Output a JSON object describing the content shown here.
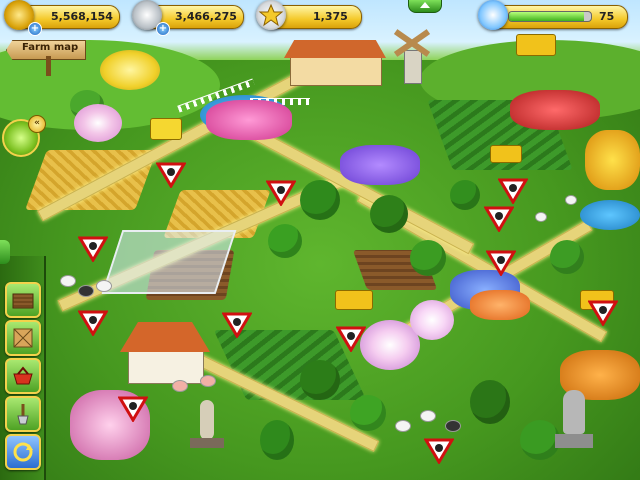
{
  "hud": {
    "coins": {
      "value": "5,568,154",
      "icon": "gold-coins-icon"
    },
    "silver": {
      "value": "3,466,275",
      "icon": "silver-coin-icon"
    },
    "stars": {
      "value": "1,375",
      "icon": "star-icon"
    },
    "energy": {
      "value": "75",
      "fill_fraction": 0.92,
      "icon": "farmer-avatar-icon"
    }
  },
  "farm_map": {
    "label": "Farm map"
  },
  "toolbar": {
    "tools": [
      {
        "icon": "field-plot-icon"
      },
      {
        "icon": "wooden-crate-icon"
      },
      {
        "icon": "shopping-basket-icon"
      },
      {
        "icon": "shovel-icon"
      },
      {
        "icon": "recycle-icon"
      }
    ]
  },
  "colors": {
    "hud_gold": "#f4c92a",
    "toolbar_green": "#3f8c1c",
    "energy_green": "#3fb21c"
  }
}
